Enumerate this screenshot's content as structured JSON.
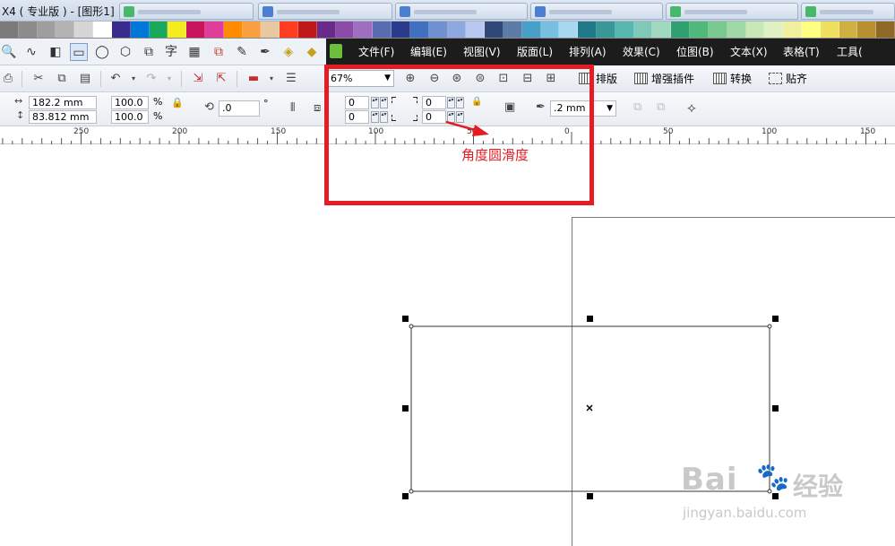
{
  "window": {
    "title": "X4 ( 专业版 ) - [图形1]",
    "taskbar_tab_icon_colors": [
      "#47b86a",
      "#4a7fd1",
      "#4a7fd1",
      "#4a7fd1",
      "#47b86a",
      "#47b86a"
    ]
  },
  "palette": {
    "colors": [
      "#7a7a7a",
      "#8c8c8c",
      "#9e9e9e",
      "#b3b3b3",
      "#d6d6d6",
      "#ffffff",
      "#3a2c8c",
      "#0078d7",
      "#1aa85c",
      "#f4ec1f",
      "#c8145a",
      "#e23c9a",
      "#ff8c00",
      "#f8a040",
      "#e8c8a0",
      "#ff3c1e",
      "#c01818",
      "#6a2a8a",
      "#8a4aa8",
      "#a06ec0",
      "#5a6cb0",
      "#2c3c8c",
      "#4070c0",
      "#7090d0",
      "#90a8e0",
      "#b8c8f0",
      "#304878",
      "#5c7ca8",
      "#48a0c8",
      "#78c0e0",
      "#a8d8f0",
      "#207888",
      "#389898",
      "#58b8b0",
      "#80c8b8",
      "#a0d8c0",
      "#30a070",
      "#50b878",
      "#78c890",
      "#a0d8a8",
      "#c8e8b8",
      "#e0f0c0",
      "#f0f0a0",
      "#ffff80",
      "#f0e060",
      "#d0b040",
      "#b89030",
      "#906828"
    ]
  },
  "toolbox": {
    "icons": [
      "zoom-icon",
      "freehand-icon",
      "smart-fill-icon",
      "rectangle-icon",
      "ellipse-icon",
      "polygon-icon",
      "basic-shapes-icon",
      "text-icon",
      "table-icon",
      "blend-icon",
      "eyedropper-icon",
      "outline-pen-icon",
      "fill-icon",
      "interactive-fill-icon"
    ],
    "glyphs": [
      "🔍",
      "∿",
      "◧",
      "▭",
      "◯",
      "⬡",
      "⧉",
      "字",
      "▦",
      "⧉",
      "✎",
      "✒",
      "◈",
      "◆"
    ],
    "text_tool_label": "字"
  },
  "menubar": {
    "items": [
      "文件(F)",
      "编辑(E)",
      "视图(V)",
      "版面(L)",
      "排列(A)",
      "效果(C)",
      "位图(B)",
      "文本(X)",
      "表格(T)",
      "工具("
    ]
  },
  "standard_toolbar": {
    "zoom_value": "67%",
    "plugins": [
      {
        "label": "排版",
        "icon": "layout-plugin-icon"
      },
      {
        "label": "增强插件",
        "icon": "enhance-plugin-icon"
      },
      {
        "label": "转换",
        "icon": "convert-plugin-icon"
      },
      {
        "label": "贴齐",
        "icon": "snap-icon"
      }
    ]
  },
  "property_bar": {
    "width": "182.2 mm",
    "height": "83.812 mm",
    "scale_x": "100.0",
    "scale_y": "100.0",
    "percent_symbol": "%",
    "rotation": ".0",
    "degree_symbol": "°",
    "corners": {
      "top_left": "0",
      "bottom_left": "0",
      "top_right": "0",
      "bottom_right": "0"
    },
    "outline_width": ".2 mm"
  },
  "ruler": {
    "labels": [
      "250",
      "200",
      "150",
      "100",
      "50",
      "0",
      "50",
      "100",
      "150"
    ]
  },
  "annotation": {
    "text": "角度圆滑度",
    "color": "#e51c23"
  },
  "watermark": {
    "brand": "Bai",
    "brand2": "经验",
    "url": "jingyan.baidu.com"
  }
}
